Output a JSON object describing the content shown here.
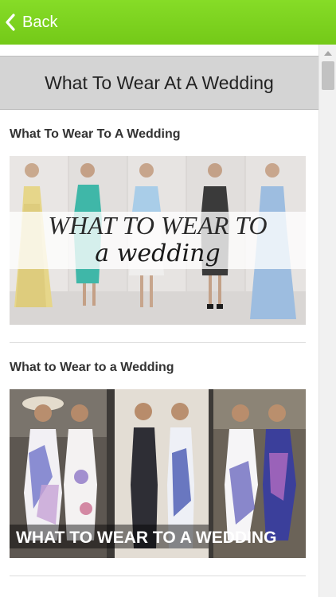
{
  "topbar": {
    "back_label": "Back",
    "color": "#7ed321"
  },
  "page": {
    "title": "What To Wear At A Wedding"
  },
  "articles": [
    {
      "title": "What To Wear To A Wedding",
      "image_text_line1": "WHAT TO WEAR TO",
      "image_text_line2": "a wedding"
    },
    {
      "title": "What to Wear to a Wedding",
      "image_text": "WHAT TO WEAR TO A WEDDING"
    }
  ]
}
